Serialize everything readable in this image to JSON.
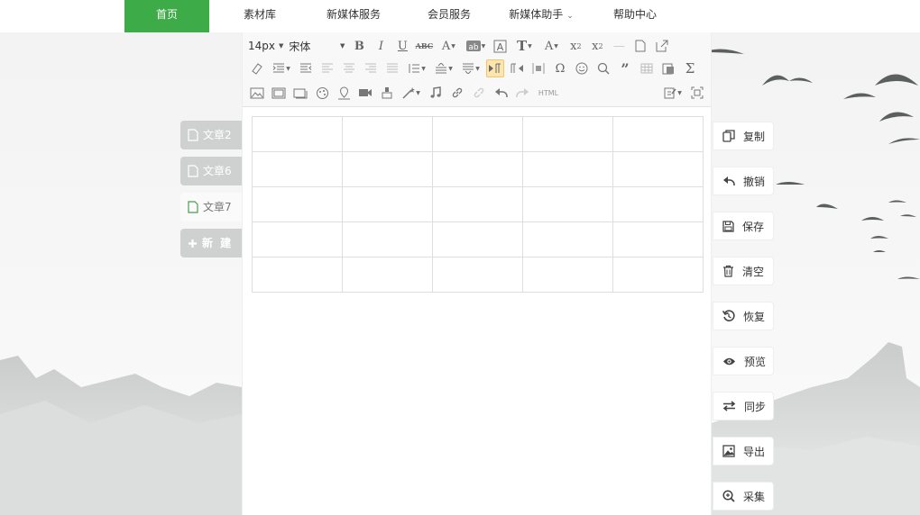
{
  "nav": {
    "items": [
      {
        "label": "首页",
        "active": true
      },
      {
        "label": "素材库"
      },
      {
        "label": "新媒体服务"
      },
      {
        "label": "会员服务"
      },
      {
        "label": "新媒体助手",
        "has_dropdown": true
      },
      {
        "label": "帮助中心"
      }
    ],
    "accent_color": "#3dab47"
  },
  "doc_tabs": {
    "items": [
      {
        "label": "文章2"
      },
      {
        "label": "文章6"
      },
      {
        "label": "文章7",
        "active": true
      }
    ],
    "new_label": "新 建"
  },
  "toolbar": {
    "font_size": "14px",
    "font_family": "宋体",
    "html_label": "HTML",
    "row1_icons": [
      "bold-icon",
      "italic-icon",
      "underline-icon",
      "strikethrough-icon",
      "font-color-icon",
      "background-color-icon",
      "border-text-icon",
      "font-style-icon",
      "font-size-icon",
      "superscript-icon",
      "subscript-icon",
      "horizontal-rule-icon",
      "new-page-icon",
      "import-icon"
    ],
    "row2_icons": [
      "eraser-icon",
      "indent-icon",
      "outdent-icon",
      "align-left-icon",
      "align-center-icon",
      "align-right-icon",
      "align-justify-icon",
      "line-height-icon",
      "paragraph-spacing-icon",
      "paragraph-format-icon",
      "ltr-icon",
      "rtl-icon",
      "insert-frame-icon",
      "special-char-icon",
      "emoji-icon",
      "search-icon",
      "quote-icon",
      "table-icon",
      "paste-icon",
      "formula-icon"
    ],
    "row3_icons": [
      "image-icon",
      "multi-image-icon",
      "video-frame-icon",
      "template-icon",
      "map-icon",
      "video-icon",
      "format-brush-icon",
      "magic-wand-icon",
      "music-icon",
      "link-icon",
      "unlink-icon",
      "undo-icon",
      "redo-icon",
      "html-icon"
    ],
    "right_icons": [
      "edit-mode-icon",
      "fullscreen-icon"
    ]
  },
  "table": {
    "rows": 5,
    "cols": 5
  },
  "actions": [
    {
      "label": "复制",
      "icon": "copy-icon"
    },
    {
      "label": "撤销",
      "icon": "undo-icon"
    },
    {
      "label": "保存",
      "icon": "save-icon"
    },
    {
      "label": "清空",
      "icon": "trash-icon"
    },
    {
      "label": "恢复",
      "icon": "restore-icon"
    },
    {
      "label": "预览",
      "icon": "eye-icon"
    },
    {
      "label": "同步",
      "icon": "sync-icon"
    },
    {
      "label": "导出",
      "icon": "export-image-icon"
    },
    {
      "label": "采集",
      "icon": "zoom-in-icon"
    }
  ]
}
